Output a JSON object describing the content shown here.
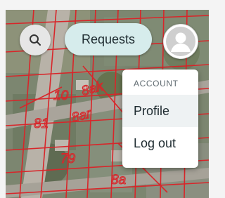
{
  "toolbar": {
    "search_icon": "search-icon",
    "requests_label": "Requests",
    "avatar_icon": "user-avatar-icon"
  },
  "account_menu": {
    "header": "ACCOUNT",
    "items": [
      {
        "label": "Profile",
        "active": true
      },
      {
        "label": "Log out",
        "active": false
      }
    ]
  },
  "map": {
    "parcel_numbers": [
      "10",
      "8ak",
      "81",
      "8ar",
      "79",
      "8a"
    ],
    "parcel_line_color": "#d8262a"
  },
  "colors": {
    "pill_background": "#d6ecec",
    "menu_background": "#ffffff",
    "page_background": "#f4f4f4"
  }
}
